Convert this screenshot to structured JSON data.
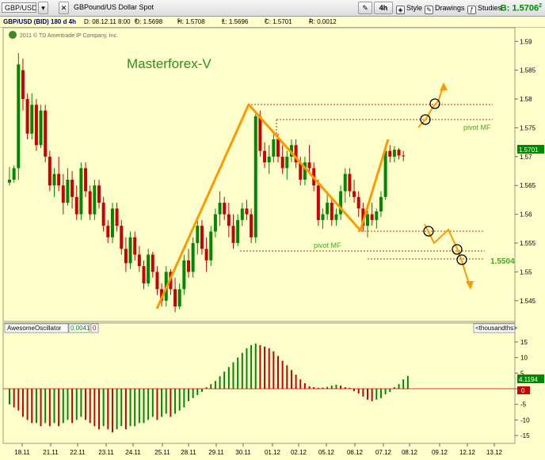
{
  "toolbar": {
    "symbol": "GBP/USD",
    "description": "GBPound/US Dollar Spot",
    "timeframe": "4h",
    "style_label": "Style",
    "drawings_label": "Drawings",
    "studies_label": "Studies",
    "bid_label": "B: 1.5706",
    "bid_superscript": "2"
  },
  "infobar": {
    "title": "GBP/USD (BID) 180 d 4h",
    "date": "D: 08.12.11 8:00",
    "open": "O: 1.5698",
    "open_sup": "8",
    "high": "H: 1.5708",
    "high_sup": "5",
    "low": "L: 1.5696",
    "low_sup": "4",
    "close": "C: 1.5701",
    "close_sup": "2",
    "range": "R: 0.0012",
    "range_sup": "2"
  },
  "copyright": "2011 © TD Ameritrade IP Company, Inc.",
  "watermark": "Masterforex-V",
  "annotations": {
    "pivot_upper": "pivot MF",
    "pivot_lower": "pivot MF",
    "target_level": "1.5504",
    "current_price_tag": "1.5701",
    "osc_value_tag": "4.1194",
    "osc_zero_tag": "0"
  },
  "oscillator_header": {
    "name": "AwesomeOscillator",
    "value": "0.0041",
    "value2": "0",
    "units": "<thousandths>"
  },
  "colors": {
    "background": "#ffffcc",
    "bull": "#008800",
    "bear": "#cc0000",
    "zigzag": "#ff9900",
    "pivot_line": "#dd2222",
    "watermark": "#2f8f1f",
    "grid": "#c8c8a0"
  },
  "chart_data": [
    {
      "type": "candlestick",
      "title": "GBP/USD (BID) 180 d 4h",
      "x_tick_labels": [
        "18.11",
        "21.11",
        "22.11",
        "23.11",
        "24.11",
        "25.11",
        "28.11",
        "29.11",
        "30.11",
        "01.12",
        "02.12",
        "05.12",
        "06.12",
        "07.12",
        "08.12",
        "09.12",
        "12.12",
        "13.12"
      ],
      "y_tick_labels": [
        "1.545",
        "1.55",
        "1.555",
        "1.56",
        "1.565",
        "1.57",
        "1.575",
        "1.58",
        "1.585",
        "1.59"
      ],
      "ylim": [
        1.5425,
        1.591
      ],
      "grid": false,
      "candles": [
        [
          1.5655,
          1.5682,
          1.565,
          1.566
        ],
        [
          1.566,
          1.5685,
          1.5655,
          1.568
        ],
        [
          1.568,
          1.588,
          1.566,
          1.586
        ],
        [
          1.585,
          1.587,
          1.578,
          1.58
        ],
        [
          1.58,
          1.581,
          1.573,
          1.574
        ],
        [
          1.574,
          1.581,
          1.573,
          1.579
        ],
        [
          1.579,
          1.58,
          1.571,
          1.572
        ],
        [
          1.572,
          1.579,
          1.5715,
          1.578
        ],
        [
          1.578,
          1.579,
          1.569,
          1.57
        ],
        [
          1.57,
          1.571,
          1.564,
          1.565
        ],
        [
          1.565,
          1.568,
          1.563,
          1.567
        ],
        [
          1.567,
          1.57,
          1.564,
          1.565
        ],
        [
          1.565,
          1.567,
          1.56,
          1.562
        ],
        [
          1.562,
          1.568,
          1.5615,
          1.566
        ],
        [
          1.566,
          1.5675,
          1.561,
          1.563
        ],
        [
          1.563,
          1.565,
          1.559,
          1.56
        ],
        [
          1.56,
          1.569,
          1.559,
          1.568
        ],
        [
          1.568,
          1.569,
          1.563,
          1.564
        ],
        [
          1.564,
          1.565,
          1.559,
          1.56
        ],
        [
          1.56,
          1.566,
          1.559,
          1.565
        ],
        [
          1.565,
          1.566,
          1.561,
          1.562
        ],
        [
          1.562,
          1.563,
          1.557,
          1.558
        ],
        [
          1.558,
          1.559,
          1.555,
          1.556
        ],
        [
          1.556,
          1.562,
          1.555,
          1.561
        ],
        [
          1.561,
          1.562,
          1.557,
          1.558
        ],
        [
          1.558,
          1.559,
          1.553,
          1.554
        ],
        [
          1.554,
          1.556,
          1.55,
          1.5515
        ],
        [
          1.5515,
          1.557,
          1.5505,
          1.556
        ],
        [
          1.556,
          1.557,
          1.552,
          1.553
        ],
        [
          1.553,
          1.5545,
          1.55,
          1.551
        ],
        [
          1.551,
          1.552,
          1.547,
          1.548
        ],
        [
          1.548,
          1.554,
          1.5475,
          1.553
        ],
        [
          1.553,
          1.5535,
          1.549,
          1.55
        ],
        [
          1.55,
          1.551,
          1.546,
          1.547
        ],
        [
          1.547,
          1.548,
          1.544,
          1.545
        ],
        [
          1.545,
          1.551,
          1.544,
          1.55
        ],
        [
          1.55,
          1.5505,
          1.546,
          1.547
        ],
        [
          1.547,
          1.549,
          1.543,
          1.544
        ],
        [
          1.544,
          1.548,
          1.5435,
          1.547
        ],
        [
          1.547,
          1.553,
          1.546,
          1.552
        ],
        [
          1.552,
          1.554,
          1.549,
          1.55
        ],
        [
          1.55,
          1.556,
          1.549,
          1.555
        ],
        [
          1.555,
          1.559,
          1.553,
          1.558
        ],
        [
          1.558,
          1.559,
          1.553,
          1.554
        ],
        [
          1.554,
          1.556,
          1.55,
          1.552
        ],
        [
          1.552,
          1.558,
          1.551,
          1.557
        ],
        [
          1.557,
          1.561,
          1.556,
          1.56
        ],
        [
          1.56,
          1.564,
          1.558,
          1.562
        ],
        [
          1.562,
          1.563,
          1.559,
          1.56
        ],
        [
          1.56,
          1.562,
          1.556,
          1.558
        ],
        [
          1.558,
          1.56,
          1.554,
          1.555
        ],
        [
          1.555,
          1.56,
          1.5545,
          1.559
        ],
        [
          1.559,
          1.562,
          1.558,
          1.561
        ],
        [
          1.561,
          1.5625,
          1.559,
          1.56
        ],
        [
          1.56,
          1.561,
          1.555,
          1.556
        ],
        [
          1.556,
          1.578,
          1.555,
          1.577
        ],
        [
          1.577,
          1.578,
          1.57,
          1.571
        ],
        [
          1.571,
          1.5725,
          1.568,
          1.569
        ],
        [
          1.569,
          1.572,
          1.567,
          1.57
        ],
        [
          1.57,
          1.574,
          1.569,
          1.573
        ],
        [
          1.573,
          1.574,
          1.569,
          1.57
        ],
        [
          1.57,
          1.572,
          1.567,
          1.568
        ],
        [
          1.568,
          1.571,
          1.566,
          1.57
        ],
        [
          1.57,
          1.573,
          1.569,
          1.572
        ],
        [
          1.572,
          1.573,
          1.568,
          1.569
        ],
        [
          1.569,
          1.57,
          1.565,
          1.566
        ],
        [
          1.566,
          1.57,
          1.565,
          1.569
        ],
        [
          1.569,
          1.572,
          1.567,
          1.568
        ],
        [
          1.568,
          1.569,
          1.564,
          1.565
        ],
        [
          1.565,
          1.566,
          1.558,
          1.559
        ],
        [
          1.559,
          1.561,
          1.5575,
          1.56
        ],
        [
          1.56,
          1.564,
          1.559,
          1.562
        ],
        [
          1.562,
          1.563,
          1.558,
          1.559
        ],
        [
          1.559,
          1.561,
          1.558,
          1.56
        ],
        [
          1.56,
          1.565,
          1.559,
          1.564
        ],
        [
          1.564,
          1.568,
          1.562,
          1.567
        ],
        [
          1.567,
          1.568,
          1.563,
          1.564
        ],
        [
          1.564,
          1.566,
          1.562,
          1.563
        ],
        [
          1.563,
          1.564,
          1.5595,
          1.561
        ],
        [
          1.561,
          1.562,
          1.557,
          1.558
        ],
        [
          1.558,
          1.561,
          1.556,
          1.56
        ],
        [
          1.56,
          1.562,
          1.558,
          1.559
        ],
        [
          1.559,
          1.561,
          1.5575,
          1.5605
        ],
        [
          1.5605,
          1.564,
          1.5595,
          1.563
        ],
        [
          1.563,
          1.572,
          1.5625,
          1.571
        ],
        [
          1.571,
          1.572,
          1.569,
          1.57
        ],
        [
          1.57,
          1.5718,
          1.569,
          1.5712
        ],
        [
          1.5712,
          1.5715,
          1.5695,
          1.5702
        ],
        [
          1.5702,
          1.571,
          1.5692,
          1.5701
        ]
      ]
    },
    {
      "type": "bar",
      "title": "AwesomeOscillator",
      "units": "<thousandths>",
      "y_tick_labels": [
        "15",
        "10",
        "5",
        "0",
        "-5",
        "-10",
        "-15"
      ],
      "ylim": [
        -17,
        17
      ],
      "values": [
        -5,
        -6,
        -7,
        -9,
        -10,
        -11,
        -11,
        -12,
        -11,
        -12,
        -11,
        -12,
        -11,
        -10,
        -11,
        -10,
        -9,
        -10,
        -11,
        -12,
        -13,
        -12,
        -13,
        -14,
        -13,
        -12,
        -13,
        -12,
        -12,
        -11,
        -11,
        -10,
        -9,
        -10,
        -9,
        -8,
        -9,
        -8,
        -7,
        -6,
        -4,
        -3,
        -2,
        -1,
        0.5,
        1.5,
        2.5,
        4,
        5.5,
        7,
        8.5,
        10,
        11.5,
        13,
        14,
        14.5,
        14,
        13.5,
        13,
        12,
        10.5,
        9,
        7.5,
        6,
        4.5,
        3,
        1.8,
        0.8,
        0.5,
        0.3,
        0.4,
        0.6,
        1,
        1.3,
        1,
        0.5,
        0.3,
        -0.8,
        -1.5,
        -2.5,
        -3.5,
        -4,
        -3.5,
        -3,
        -1.8,
        -1,
        0.5,
        1.5,
        3,
        4.1
      ]
    }
  ]
}
